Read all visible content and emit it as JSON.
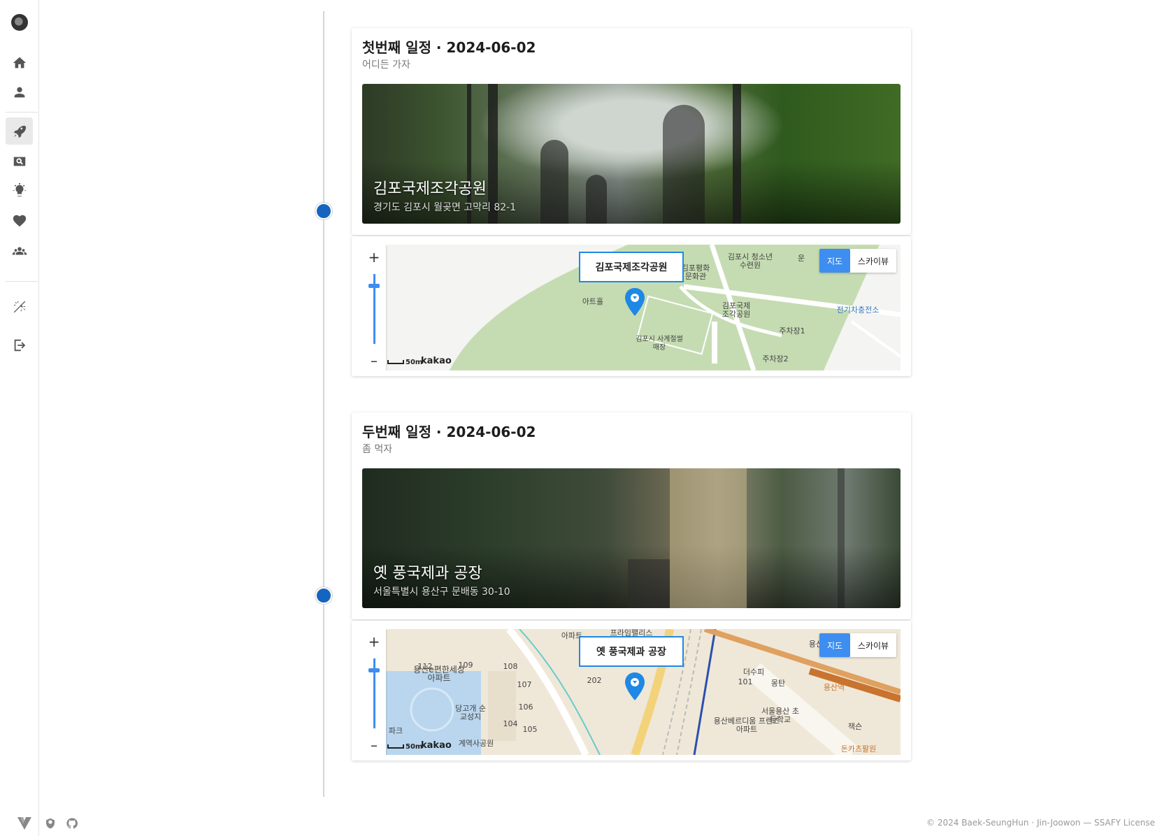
{
  "sidebar": {
    "items": [
      {
        "name": "home",
        "icon": "home-icon"
      },
      {
        "name": "profile",
        "icon": "person-icon"
      },
      {
        "name": "trip",
        "icon": "rocket-icon"
      },
      {
        "name": "search",
        "icon": "search-icon"
      },
      {
        "name": "idea",
        "icon": "lightbulb-icon"
      },
      {
        "name": "favorites",
        "icon": "heart-icon"
      },
      {
        "name": "groups",
        "icon": "group-icon"
      },
      {
        "name": "theme",
        "icon": "theme-toggle-icon"
      },
      {
        "name": "logout",
        "icon": "logout-icon"
      }
    ],
    "active": "trip"
  },
  "schedules": [
    {
      "title": "첫번째 일정 · 2024-06-02",
      "subtitle": "어디든 가자",
      "place_name": "김포국제조각공원",
      "address": "경기도 김포시 월곶면 고막리 82-1",
      "map": {
        "infowindow": "김포국제조각공원",
        "labels": [
          "김포평화 문화관",
          "김포시 청소년수련원",
          "아트홀",
          "김포국제 조각공원",
          "전기차충전소",
          "주차장1",
          "주차장2",
          "김포시 사계절썰매장",
          "운"
        ]
      }
    },
    {
      "title": "두번째 일정 · 2024-06-02",
      "subtitle": "좀 먹자",
      "place_name": "옛 풍국제과 공장",
      "address": "서울특별시 용산구 문배동 30-10",
      "map": {
        "infowindow": "옛 풍국제과 공장",
        "labels": [
          "용산e편한세상 아파트",
          "당고개 순교성지",
          "서울용산 초등학교",
          "용산베르디움 프렌즈아파트",
          "더수피",
          "몽탄",
          "용산역",
          "아파트",
          "프라임팰리스",
          "108",
          "107",
          "106",
          "105",
          "104",
          "202",
          "112",
          "109",
          "101",
          "파크",
          "계역사공원",
          "돈카츠팔원",
          "잭슨",
          "용산"
        ]
      }
    }
  ],
  "map_controls": {
    "zoom_in": "+",
    "zoom_out": "–",
    "map_type_map": "지도",
    "map_type_sky": "스카이뷰",
    "scale": "50m",
    "brand": "kakao"
  },
  "footer": {
    "copyright": "© 2024 Baek-SeungHun · Jin-Joowon — SSAFY License"
  },
  "colors": {
    "accent": "#1565c0",
    "map_button": "#3d8ef0",
    "infowindow_border": "#1e88e5"
  }
}
